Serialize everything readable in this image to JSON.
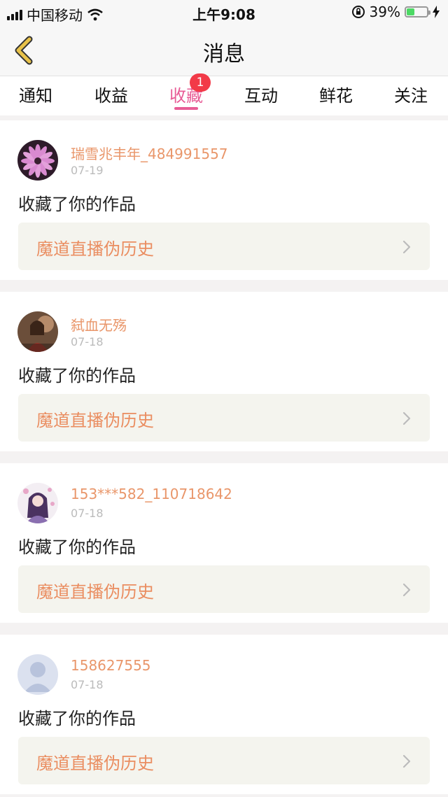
{
  "status_bar": {
    "carrier": "中国移动",
    "time": "上午9:08",
    "battery_percent": "39%",
    "battery_level": 0.39,
    "icons": [
      "signal-icon",
      "wifi-icon",
      "orientation-lock-icon",
      "battery-icon",
      "charging-icon"
    ]
  },
  "nav": {
    "title": "消息",
    "back_icon": "chevron-left-icon"
  },
  "tabs": [
    {
      "label": "通知",
      "active": false
    },
    {
      "label": "收益",
      "active": false
    },
    {
      "label": "收藏",
      "active": true,
      "badge": "1"
    },
    {
      "label": "互动",
      "active": false
    },
    {
      "label": "鲜花",
      "active": false
    },
    {
      "label": "关注",
      "active": false
    }
  ],
  "messages": [
    {
      "username": "瑞雪兆丰年_484991557",
      "date": "07-19",
      "action": "收藏了你的作品",
      "work_title": "魔道直播伪历史",
      "avatar": "flower-avatar"
    },
    {
      "username": "弑血无殇",
      "date": "07-18",
      "action": "收藏了你的作品",
      "work_title": "魔道直播伪历史",
      "avatar": "character-avatar"
    },
    {
      "username": "153***582_110718642",
      "date": "07-18",
      "action": "收藏了你的作品",
      "work_title": "魔道直播伪历史",
      "avatar": "anime-avatar"
    },
    {
      "username": "158627555",
      "date": "07-18",
      "action": "收藏了你的作品",
      "work_title": "魔道直播伪历史",
      "avatar": "default-avatar"
    }
  ],
  "colors": {
    "accent": "#e85c96",
    "username": "#e9966a",
    "work_title": "#ea8d60",
    "badge": "#f23a48",
    "back_icon": "#e8c24a"
  }
}
